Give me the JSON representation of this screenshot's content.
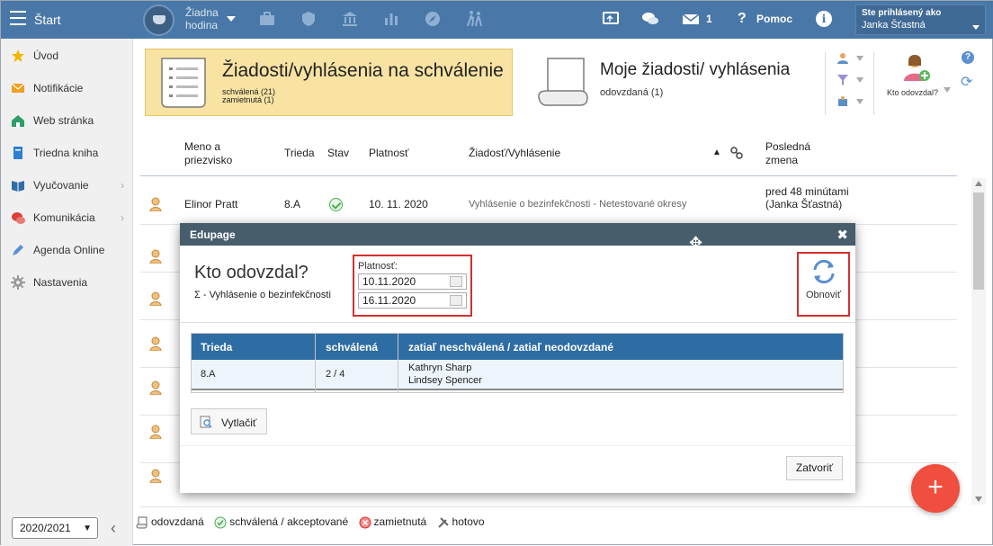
{
  "topbar": {
    "start_label": "Štart",
    "hour_line1": "Žiadna",
    "hour_line2": "hodina",
    "messages_count": "1",
    "help_label": "Pomoc",
    "info_mark": "i",
    "user_label": "Ste prihlásený ako",
    "user_name": "Janka Šťastná"
  },
  "sidebar": {
    "items": [
      {
        "label": "Úvod",
        "icon": "star-icon"
      },
      {
        "label": "Notifikácie",
        "icon": "envelope-icon"
      },
      {
        "label": "Web stránka",
        "icon": "house-icon"
      },
      {
        "label": "Triedna kniha",
        "icon": "book-icon"
      },
      {
        "label": "Vyučovanie",
        "icon": "open-book-icon"
      },
      {
        "label": "Komunikácia",
        "icon": "chat-icon"
      },
      {
        "label": "Agenda Online",
        "icon": "pen-icon"
      },
      {
        "label": "Nastavenia",
        "icon": "gear-icon"
      }
    ],
    "year_value": "2020/2021",
    "collapse_glyph": "‹"
  },
  "cards": {
    "approval_title": "Žiadosti/vyhlásenia na schválenie",
    "approval_sub1": "schválená (21)",
    "approval_sub2": "zamietnutá (1)",
    "mine_title": "Moje žiadosti/ vyhlásenia",
    "mine_sub": "odovzdaná (1)",
    "who_label": "Kto odovzdal?"
  },
  "table": {
    "headers": {
      "name": "Meno a priezvisko",
      "class": "Trieda",
      "state": "Stav",
      "validity": "Platnosť",
      "request": "Žiadosť/Vyhlásenie",
      "sort_glyph": "▲",
      "last_change": "Posledná zmena"
    },
    "rows": [
      {
        "name": "Elinor Pratt",
        "class": "8.A",
        "validity": "10. 11. 2020",
        "request": "Vyhlásenie o bezinfekčnosti - Netestované okresy",
        "last_change": "pred 48 minútami (Janka Šťastná)"
      }
    ]
  },
  "legend": {
    "submitted": "odovzdaná",
    "approved": "schválená / akceptované",
    "rejected": "zamietnutá",
    "done": "hotovo"
  },
  "fab_label": "+",
  "modal": {
    "title_bar": "Edupage",
    "close_glyph": "✖",
    "move_glyph": "✥",
    "heading": "Kto odovzdal?",
    "subtitle": "Σ - Vyhlásenie o bezinfekčnosti",
    "validity_label": "Platnosť:",
    "date_from": "10.11.2020",
    "date_to": "16.11.2020",
    "refresh_label": "Obnoviť",
    "table": {
      "headers": {
        "class": "Trieda",
        "approved": "schválená",
        "pending": "zatiaľ neschválená / zatiaľ neodovzdané"
      },
      "rows": [
        {
          "class": "8.A",
          "approved": "2 / 4",
          "pending_1": "Kathryn Sharp",
          "pending_2": "Lindsey Spencer"
        }
      ]
    },
    "print_label": "Vytlačiť",
    "close_label": "Zatvoriť"
  },
  "colors": {
    "topbar": "#4978a8",
    "modal_header": "#475d6c",
    "modal_table_header": "#2e6ca4",
    "highlight": "#d32f2f",
    "fab": "#f04e3e",
    "approval_card": "#f8e3a3"
  }
}
